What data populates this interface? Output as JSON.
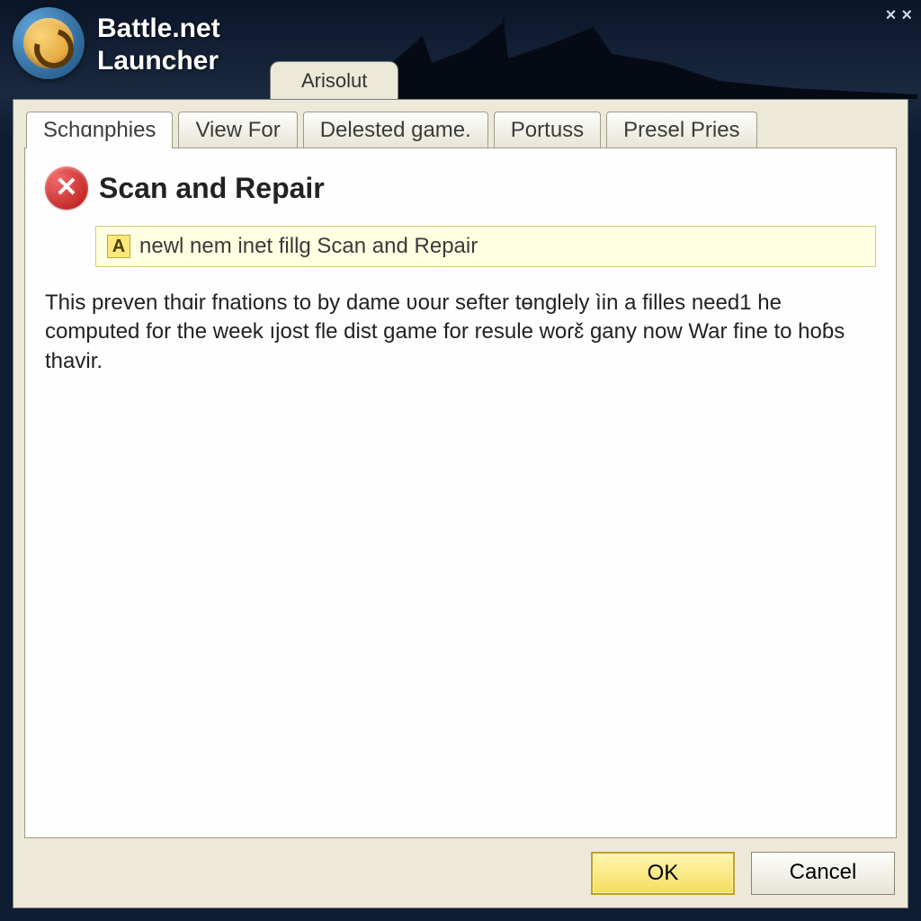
{
  "header": {
    "app_title_line1": "Battle.net",
    "app_title_line2": "Launcher",
    "upper_tab": "Arisolut"
  },
  "tabs": [
    {
      "label": "Schɑnphies",
      "active": true
    },
    {
      "label": "View For",
      "active": false
    },
    {
      "label": "Delested game.",
      "active": false
    },
    {
      "label": "Portuss",
      "active": false
    },
    {
      "label": "Presel Pries",
      "active": false
    }
  ],
  "panel": {
    "heading": "Scan and Repair",
    "info_prefix": "A",
    "info_text": "newl nem inet fillg Scan and Repair",
    "body": "This preven thɑir fnations to by dame ʋour sefter tɵnglely ìin a filles need1 he computed for the week ıjost fle dist game for resule woɾɛ̌ gany now War fine to hoɓs thavir."
  },
  "buttons": {
    "ok": "OK",
    "cancel": "Cancel"
  }
}
